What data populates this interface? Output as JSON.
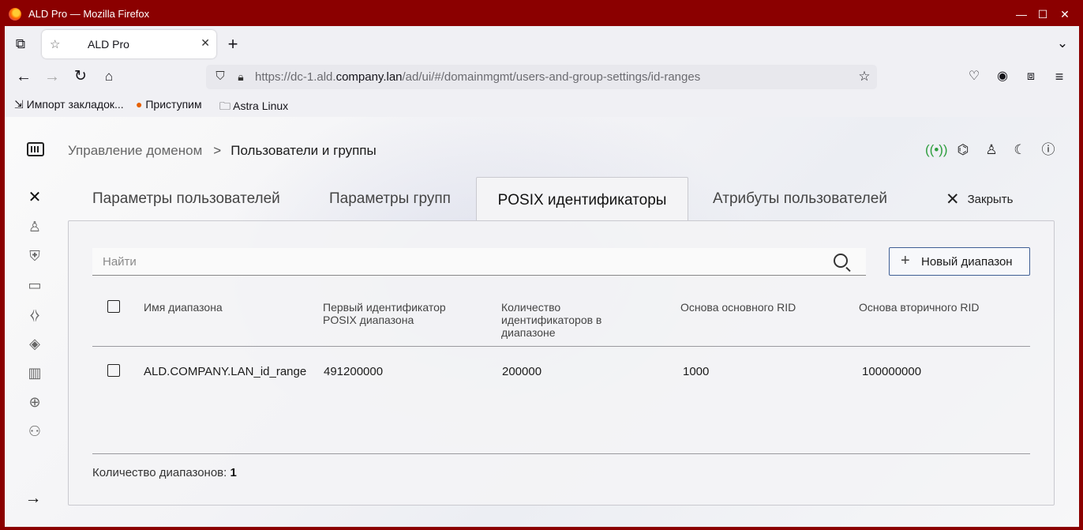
{
  "window": {
    "title": "ALD Pro — Mozilla Firefox",
    "minimize": "—",
    "maximize": "☐",
    "close": "✕"
  },
  "browser": {
    "tab_title": "ALD Pro",
    "url_prefix": "https://dc-1.ald.",
    "url_domain": "company.lan",
    "url_path": "/ad/ui/#/domainmgmt/users-and-group-settings/id-ranges",
    "bookmarks": [
      "Импорт закладок...",
      "Приступим",
      "Astra Linux"
    ]
  },
  "breadcrumb": {
    "parent": "Управление доменом",
    "separator": ">",
    "current": "Пользователи и группы"
  },
  "tabs": {
    "users": "Параметры пользователей",
    "groups": "Параметры групп",
    "posix": "POSIX идентификаторы",
    "attributes": "Атрибуты пользователей",
    "close": "Закрыть"
  },
  "search": {
    "placeholder": "Найти"
  },
  "new_range_button": "Новый диапазон",
  "table": {
    "headers": {
      "name": "Имя диапазона",
      "first_id": "Первый идентификатор POSIX диапазона",
      "count": "Количество идентификаторов в диапазоне",
      "primary_rid": "Основа основного RID",
      "secondary_rid": "Основа вторичного RID"
    },
    "rows": [
      {
        "name": "ALD.COMPANY.LAN_id_range",
        "first_id": "491200000",
        "count": "200000",
        "primary_rid": "1000",
        "secondary_rid": "100000000"
      }
    ]
  },
  "footer": {
    "label": "Количество диапазонов:",
    "count": "1"
  },
  "colors": {
    "window_frame": "#8b0000",
    "accent_border": "#3f5f95",
    "network_icon": "#2e9e3e"
  }
}
